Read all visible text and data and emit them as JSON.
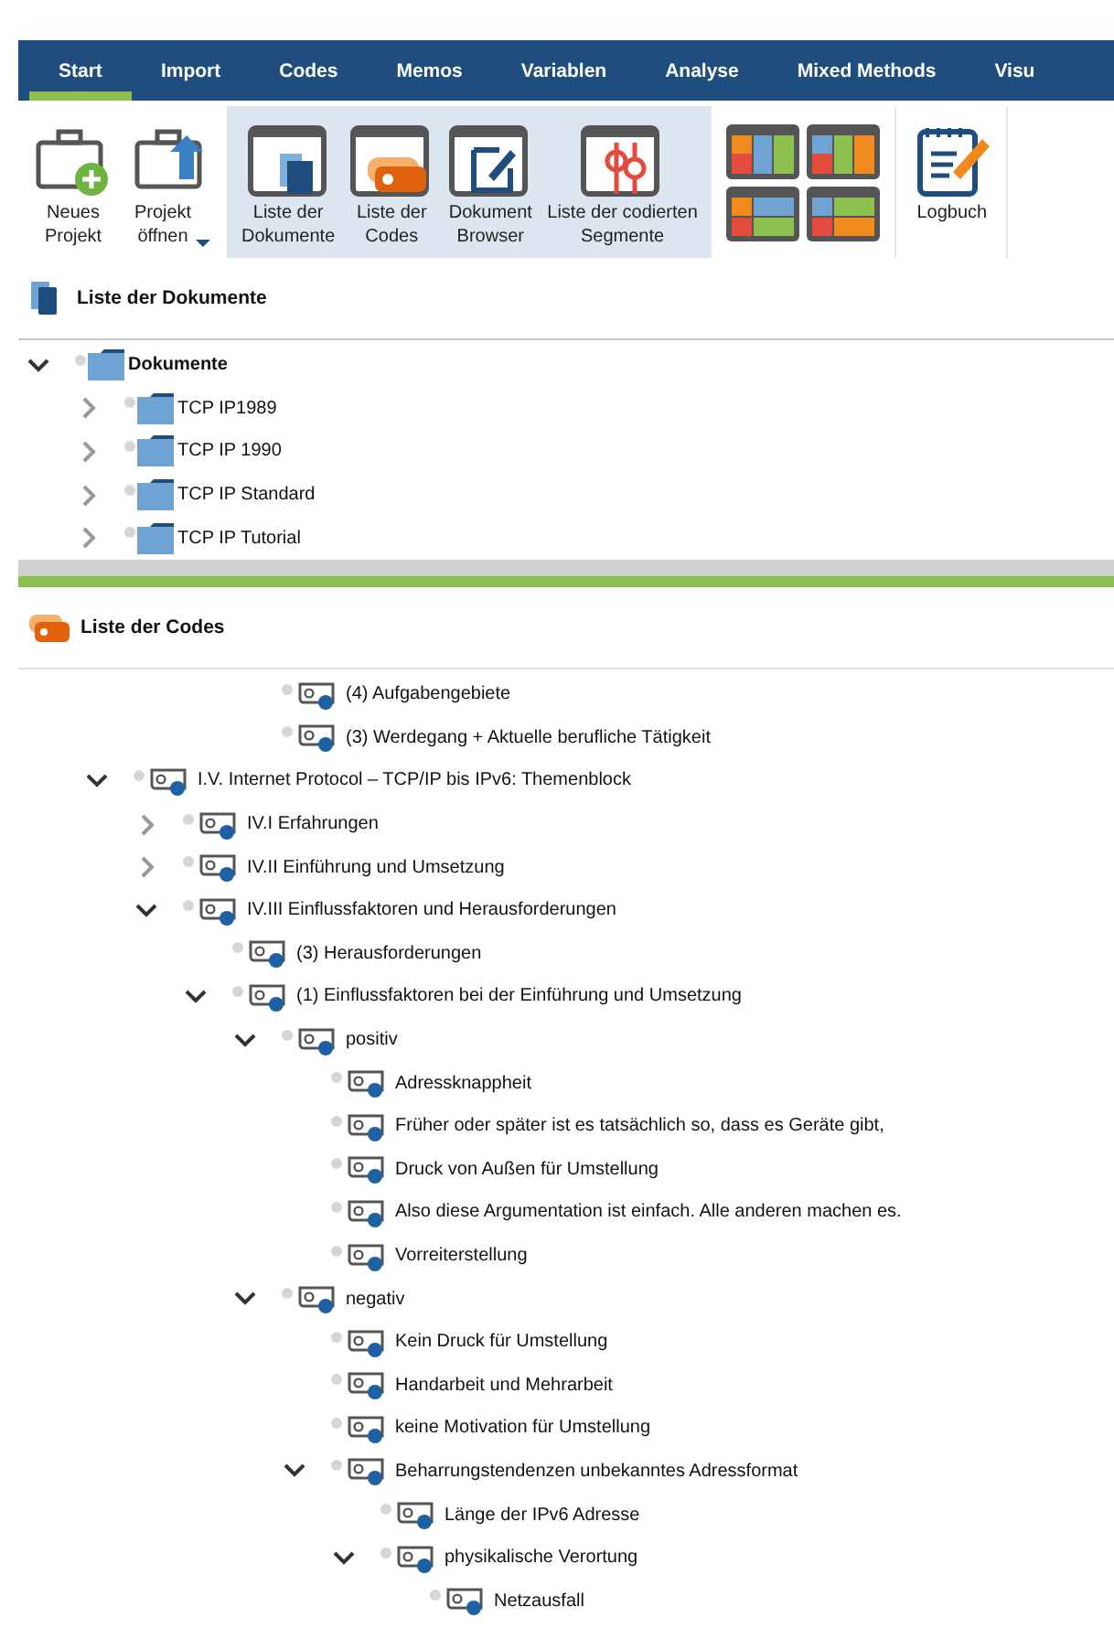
{
  "tabs": [
    {
      "label": "Start",
      "selected": true
    },
    {
      "label": "Import",
      "selected": false
    },
    {
      "label": "Codes",
      "selected": false
    },
    {
      "label": "Memos",
      "selected": false
    },
    {
      "label": "Variablen",
      "selected": false
    },
    {
      "label": "Analyse",
      "selected": false
    },
    {
      "label": "Mixed Methods",
      "selected": false
    },
    {
      "label": "Visu",
      "selected": false
    }
  ],
  "ribbon": [
    {
      "kind": "buttons",
      "selected": false,
      "buttons": [
        {
          "label": "Neues\nProjekt"
        },
        {
          "label": "Projekt\nöffnen",
          "dropdown": true
        }
      ]
    },
    {
      "kind": "buttons",
      "selected": true,
      "buttons": [
        {
          "label": "Liste der\nDokumente"
        },
        {
          "label": "Liste der\nCodes"
        },
        {
          "label": "Dokument\nBrowser"
        },
        {
          "label": "Liste der codierten\nSegmente"
        }
      ]
    },
    {
      "kind": "layouts"
    },
    {
      "kind": "buttons",
      "selected": false,
      "buttons": [
        {
          "label": "Logbuch"
        }
      ]
    }
  ],
  "documents_panel": {
    "title": "Liste der Dokumente",
    "tree": [
      {
        "label": "Dokumente",
        "expanded": true,
        "children": [
          {
            "label": "TCP IP1989",
            "expanded": false
          },
          {
            "label": "TCP IP 1990",
            "expanded": false
          },
          {
            "label": "TCP IP Standard",
            "expanded": false
          },
          {
            "label": "TCP IP Tutorial",
            "expanded": false
          }
        ]
      }
    ]
  },
  "codes_panel": {
    "title": "Liste der Codes",
    "leading_items": [
      {
        "label": "(4) Aufgabengebiete"
      },
      {
        "label": "(3) Werdegang + Aktuelle berufliche Tätigkeit"
      }
    ],
    "tree": [
      {
        "label": "I.V. Internet Protocol – TCP/IP bis IPv6: Themenblock",
        "expanded": true,
        "children": [
          {
            "label": "IV.I Erfahrungen",
            "expanded": false
          },
          {
            "label": "IV.II Einführung und Umsetzung",
            "expanded": false
          },
          {
            "label": "IV.III Einflussfaktoren und Herausforderungen",
            "expanded": true,
            "children": [
              {
                "label": "(3) Herausforderungen"
              },
              {
                "label": "(1) Einflussfaktoren bei der Einführung und Umsetzung",
                "expanded": true,
                "children": [
                  {
                    "label": "positiv",
                    "expanded": true,
                    "children": [
                      {
                        "label": "Adressknappheit"
                      },
                      {
                        "label": "Früher oder später ist es tatsächlich so, dass es Geräte gibt,"
                      },
                      {
                        "label": "Druck von Außen für Umstellung"
                      },
                      {
                        "label": "Also diese Argumentation ist einfach. Alle anderen machen es."
                      },
                      {
                        "label": "Vorreiterstellung"
                      }
                    ]
                  },
                  {
                    "label": "negativ",
                    "expanded": true,
                    "children": [
                      {
                        "label": "Kein Druck für Umstellung"
                      },
                      {
                        "label": "Handarbeit und Mehrarbeit"
                      },
                      {
                        "label": "keine Motivation für Umstellung"
                      },
                      {
                        "label": "Beharrungstendenzen unbekanntes Adressformat",
                        "expanded": true,
                        "children": [
                          {
                            "label": "Länge der IPv6 Adresse"
                          },
                          {
                            "label": "physikalische Verortung",
                            "expanded": true,
                            "children": [
                              {
                                "label": "Netzausfall"
                              }
                            ]
                          }
                        ]
                      }
                    ]
                  }
                ]
              }
            ]
          }
        ]
      }
    ]
  }
}
